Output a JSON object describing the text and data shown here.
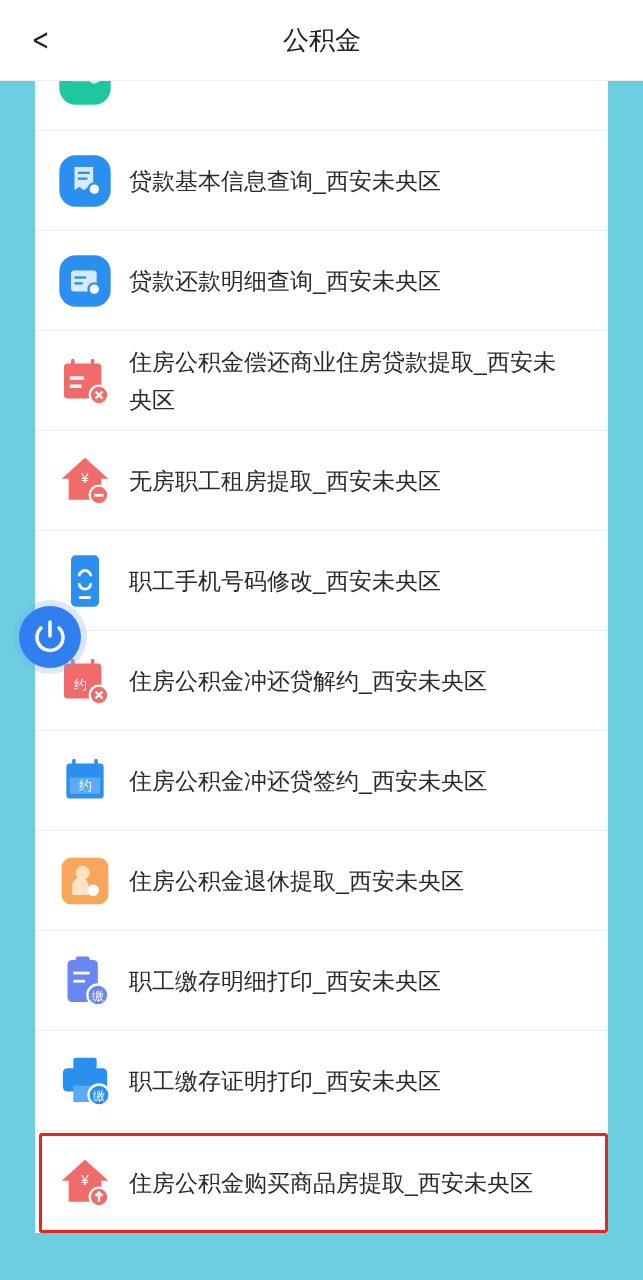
{
  "header": {
    "back": "<",
    "title": "公积金"
  },
  "items": [
    {
      "kind": "card",
      "selected": false
    },
    {
      "kind": "docsearch",
      "label": "贷款基本信息查询_西安未央区",
      "selected": false
    },
    {
      "kind": "walletsearch",
      "label": "贷款还款明细查询_西安未央区",
      "selected": false
    },
    {
      "kind": "calendarcancel",
      "label": "住房公积金偿还商业住房贷款提取_西安未央区",
      "selected": false
    },
    {
      "kind": "houseminus",
      "badge": "¥",
      "label": "无房职工租房提取_西安未央区",
      "selected": false
    },
    {
      "kind": "phone",
      "label": "职工手机号码修改_西安未央区",
      "selected": false
    },
    {
      "kind": "calendarcancel",
      "badge": "约",
      "label": "住房公积金冲还贷解约_西安未央区",
      "selected": false
    },
    {
      "kind": "calendar",
      "badge": "约",
      "label": "住房公积金冲还贷签约_西安未央区",
      "selected": false
    },
    {
      "kind": "person",
      "label": "住房公积金退休提取_西安未央区",
      "selected": false
    },
    {
      "kind": "clipboard",
      "badge": "缴",
      "label": "职工缴存明细打印_西安未央区",
      "selected": false
    },
    {
      "kind": "printer",
      "badge": "缴",
      "label": "职工缴存证明打印_西安未央区",
      "selected": false
    },
    {
      "kind": "houseup",
      "badge": "¥",
      "label": "住房公积金购买商品房提取_西安未央区",
      "selected": true
    }
  ]
}
